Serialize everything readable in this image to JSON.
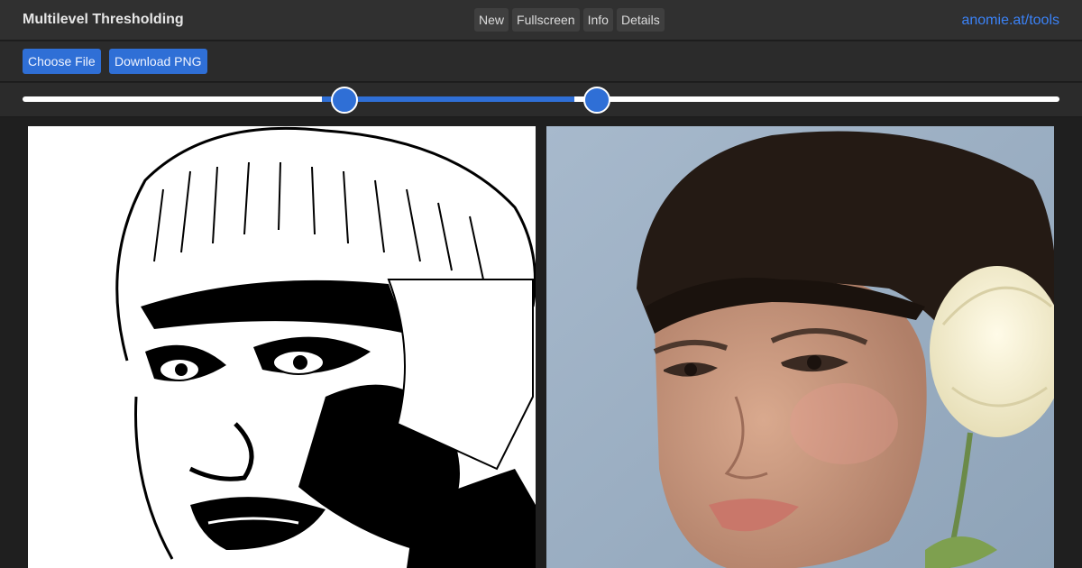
{
  "header": {
    "title": "Multilevel Thresholding",
    "nav": [
      "New",
      "Fullscreen",
      "Info",
      "Details"
    ],
    "link": "anomie.at/tools"
  },
  "toolbar": {
    "choose_file": "Choose File",
    "download_png": "Download PNG"
  },
  "slider": {
    "min": 0,
    "max": 255,
    "low": 79,
    "high": 141
  },
  "colors": {
    "accent": "#2f6fd6",
    "link": "#3b82f6",
    "header_bg": "#303030",
    "page_bg": "#1f1f1f"
  },
  "panels": {
    "left": "thresholded-image",
    "right": "original-photo"
  }
}
